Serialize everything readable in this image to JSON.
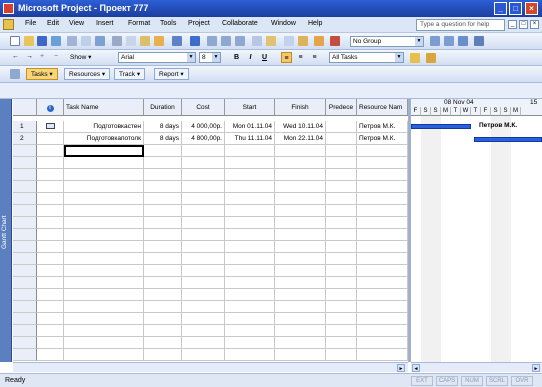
{
  "window": {
    "title": "Microsoft Project - Проект 777"
  },
  "menu": {
    "items": [
      "File",
      "Edit",
      "View",
      "Insert",
      "Format",
      "Tools",
      "Project",
      "Collaborate",
      "Window",
      "Help"
    ],
    "help_placeholder": "Type a question for help"
  },
  "toolbar": {
    "group_value": "No Group",
    "font_value": "Arial",
    "size_value": "8",
    "filter_value": "All Tasks",
    "show_label": "Show",
    "bold": "B",
    "italic": "I",
    "underline": "U"
  },
  "views": {
    "tasks": "Tasks",
    "resources": "Resources",
    "track": "Track",
    "report": "Report"
  },
  "sidebar": {
    "label": "Gantt Chart"
  },
  "table": {
    "columns": [
      "Task Name",
      "Duration",
      "Cost",
      "Start",
      "Finish",
      "Predece",
      "Resource Nam"
    ],
    "rows": [
      {
        "num": "1",
        "name": "Подготовкастен",
        "duration": "8 days",
        "cost": "4 000,00р.",
        "start": "Mon 01.11.04",
        "finish": "Wed 10.11.04",
        "pred": "",
        "resource": "Петров М.К."
      },
      {
        "num": "2",
        "name": "Подготовкапотолк",
        "duration": "8 days",
        "cost": "4 800,00р.",
        "start": "Thu 11.11.04",
        "finish": "Mon 22.11.04",
        "pred": "",
        "resource": "Петров М.К."
      }
    ]
  },
  "gantt": {
    "week1": "08 Nov 04",
    "week2": "15",
    "days": [
      "F",
      "S",
      "S",
      "M",
      "T",
      "W",
      "T",
      "F",
      "S",
      "S",
      "M"
    ],
    "bar_label": "Петров М.К."
  },
  "status": {
    "text": "Ready",
    "indicators": [
      "EXT",
      "CAPS",
      "NUM",
      "SCRL",
      "OVR"
    ]
  }
}
